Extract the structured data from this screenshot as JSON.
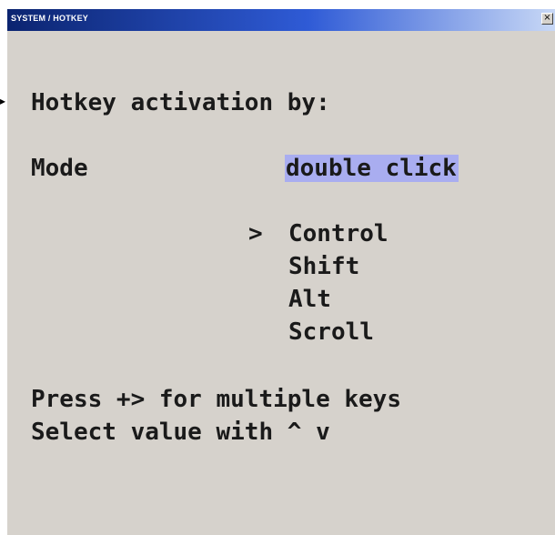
{
  "window": {
    "title": "SYSTEM / HOTKEY",
    "close_glyph": "×"
  },
  "heading": "Hotkey activation by:",
  "mode": {
    "label": "Mode",
    "value": "double click",
    "highlight_color": "#a9adf0"
  },
  "keys": {
    "selector_glyph": ">",
    "items": [
      "Control",
      "Shift",
      "Alt",
      "Scroll"
    ],
    "selected_index": 0
  },
  "help": {
    "line1": "Press +> for multiple keys",
    "line2": "Select value with ^ v"
  },
  "colors": {
    "panel_bg": "#d6d2cc",
    "titlebar_start": "#0b2470",
    "titlebar_end": "#c8d8f6",
    "text": "#1a1a1a"
  },
  "icons": {
    "pointer": "arrow-pointer-icon",
    "close": "close-icon"
  }
}
